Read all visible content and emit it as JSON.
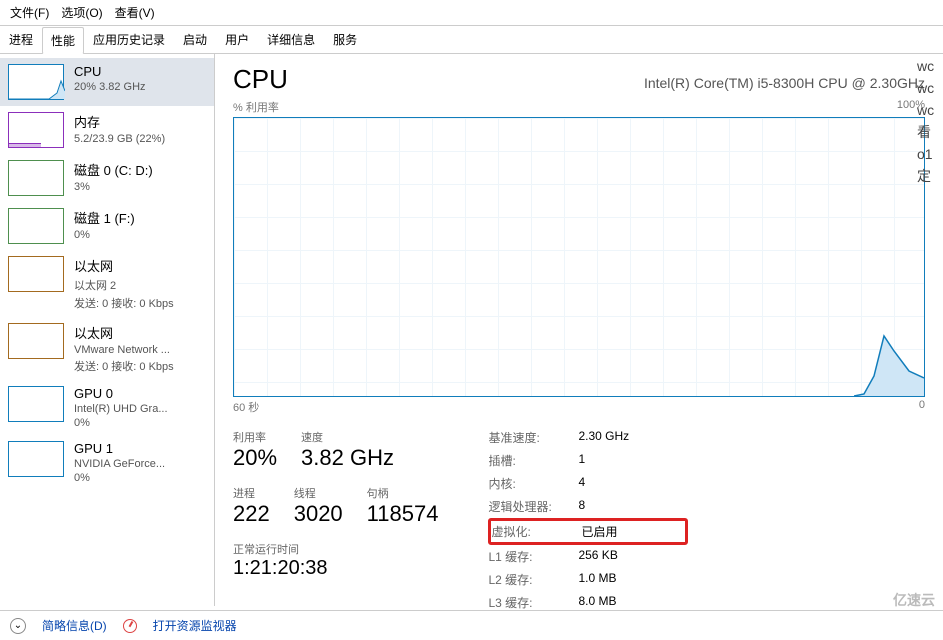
{
  "menu": {
    "file": "文件(F)",
    "options": "选项(O)",
    "view": "查看(V)"
  },
  "tabs": {
    "processes": "进程",
    "performance": "性能",
    "apphistory": "应用历史记录",
    "startup": "启动",
    "users": "用户",
    "details": "详细信息",
    "services": "服务"
  },
  "sidebar": [
    {
      "title": "CPU",
      "sub": "20% 3.82 GHz",
      "type": "cpu",
      "selected": true
    },
    {
      "title": "内存",
      "sub": "5.2/23.9 GB (22%)",
      "type": "mem"
    },
    {
      "title": "磁盘 0 (C: D:)",
      "sub": "3%",
      "type": "disk"
    },
    {
      "title": "磁盘 1 (F:)",
      "sub": "0%",
      "type": "disk"
    },
    {
      "title": "以太网",
      "sub": "以太网 2",
      "sub2": "发送: 0 接收: 0 Kbps",
      "type": "eth"
    },
    {
      "title": "以太网",
      "sub": "VMware Network ...",
      "sub2": "发送: 0 接收: 0 Kbps",
      "type": "eth"
    },
    {
      "title": "GPU 0",
      "sub": "Intel(R) UHD Gra...",
      "sub2": "0%",
      "type": "gpu"
    },
    {
      "title": "GPU 1",
      "sub": "NVIDIA GeForce...",
      "sub2": "0%",
      "type": "gpu"
    }
  ],
  "header": {
    "title": "CPU",
    "sub": "Intel(R) Core(TM) i5-8300H CPU @ 2.30GHz"
  },
  "chart": {
    "ylabel": "% 利用率",
    "ymax": "100%",
    "xleft": "60 秒",
    "xright": "0"
  },
  "chart_data": {
    "type": "line",
    "title": "% 利用率",
    "ylabel": "% 利用率",
    "ylim": [
      0,
      100
    ],
    "x_seconds": [
      60,
      55,
      50,
      45,
      40,
      35,
      30,
      25,
      20,
      15,
      10,
      5,
      4,
      3,
      2,
      1,
      0
    ],
    "values": [
      0,
      0,
      0,
      0,
      0,
      0,
      0,
      0,
      0,
      0,
      0,
      2,
      8,
      28,
      22,
      14,
      10
    ]
  },
  "stats": {
    "util": {
      "label": "利用率",
      "value": "20%"
    },
    "speed": {
      "label": "速度",
      "value": "3.82 GHz"
    },
    "proc": {
      "label": "进程",
      "value": "222"
    },
    "threads": {
      "label": "线程",
      "value": "3020"
    },
    "handles": {
      "label": "句柄",
      "value": "118574"
    },
    "uptime": {
      "label": "正常运行时间",
      "value": "1:21:20:38"
    }
  },
  "specs": {
    "base": {
      "k": "基准速度:",
      "v": "2.30 GHz"
    },
    "sockets": {
      "k": "插槽:",
      "v": "1"
    },
    "cores": {
      "k": "内核:",
      "v": "4"
    },
    "lproc": {
      "k": "逻辑处理器:",
      "v": "8"
    },
    "virt": {
      "k": "虚拟化:",
      "v": "已启用"
    },
    "l1": {
      "k": "L1 缓存:",
      "v": "256 KB"
    },
    "l2": {
      "k": "L2 缓存:",
      "v": "1.0 MB"
    },
    "l3": {
      "k": "L3 缓存:",
      "v": "8.0 MB"
    }
  },
  "footer": {
    "brief": "简略信息(D)",
    "resmon": "打开资源监视器"
  },
  "rside": [
    "wc",
    "wc",
    "wc",
    "看",
    "o1",
    "定"
  ],
  "logo": "亿速云"
}
